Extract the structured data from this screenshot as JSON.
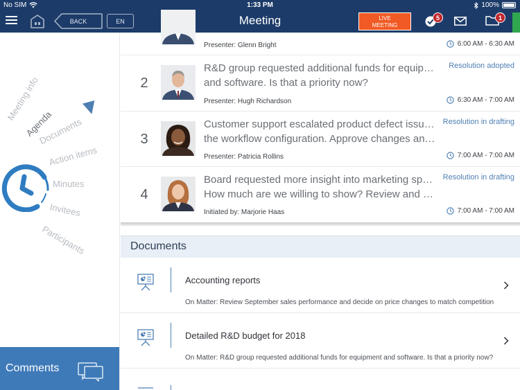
{
  "status_bar": {
    "carrier": "No SIM",
    "time": "1:33 PM",
    "battery": "100%",
    "battery_level": 1.0
  },
  "nav": {
    "back_label": "BACK",
    "language_label": "EN",
    "title": "Meeting",
    "live_label": "LIVE MEETING",
    "tasks_badge": "5",
    "folder_badge": "1"
  },
  "wheel": {
    "items": [
      "Meeting info",
      "Agenda",
      "Documents",
      "Action items",
      "Minutes",
      "Invitees",
      "Participants"
    ],
    "active": "Agenda"
  },
  "comments": {
    "label": "Comments"
  },
  "agenda": {
    "items": [
      {
        "number": "",
        "title_lines": [],
        "presenter": "Presenter: Glenn Bright",
        "status": "",
        "time": "6:00 AM - 6:30 AM"
      },
      {
        "number": "2",
        "title_lines": [
          "R&D group requested additional funds for equipment",
          "and software. Is that a priority now?"
        ],
        "presenter": "Presenter: Hugh Richardson",
        "status": "Resolution adopted",
        "time": "6:30 AM - 7:00 AM"
      },
      {
        "number": "3",
        "title_lines": [
          "Customer support escalated product defect issue in",
          "the workflow configuration. Approve changes and…"
        ],
        "presenter": "Presenter: Patricia Rollins",
        "status": "Resolution in drafting",
        "time": "7:00 AM - 7:00 AM"
      },
      {
        "number": "4",
        "title_lines": [
          "Board requested more insight into marketing spend.",
          "How much are we willing to show? Review and a…"
        ],
        "presenter": "Initiated by: Marjorie Haas",
        "status": "Resolution in drafting",
        "time": "7:00 AM - 7:00 AM"
      }
    ]
  },
  "documents": {
    "header": "Documents",
    "items": [
      {
        "title": "Accounting reports",
        "matter": "On Matter: Review September sales performance and decide on price changes to match competition"
      },
      {
        "title": "Detailed R&D budget for 2018",
        "matter": "On Matter: R&D group requested additional funds for equipment and software. Is that a priority now?"
      }
    ]
  },
  "colors": {
    "navbar": "#1c3b69",
    "accent": "#4d7fb3",
    "live": "#f15a24",
    "badge": "#c0272d",
    "comments_bar": "#3f7ab8"
  }
}
